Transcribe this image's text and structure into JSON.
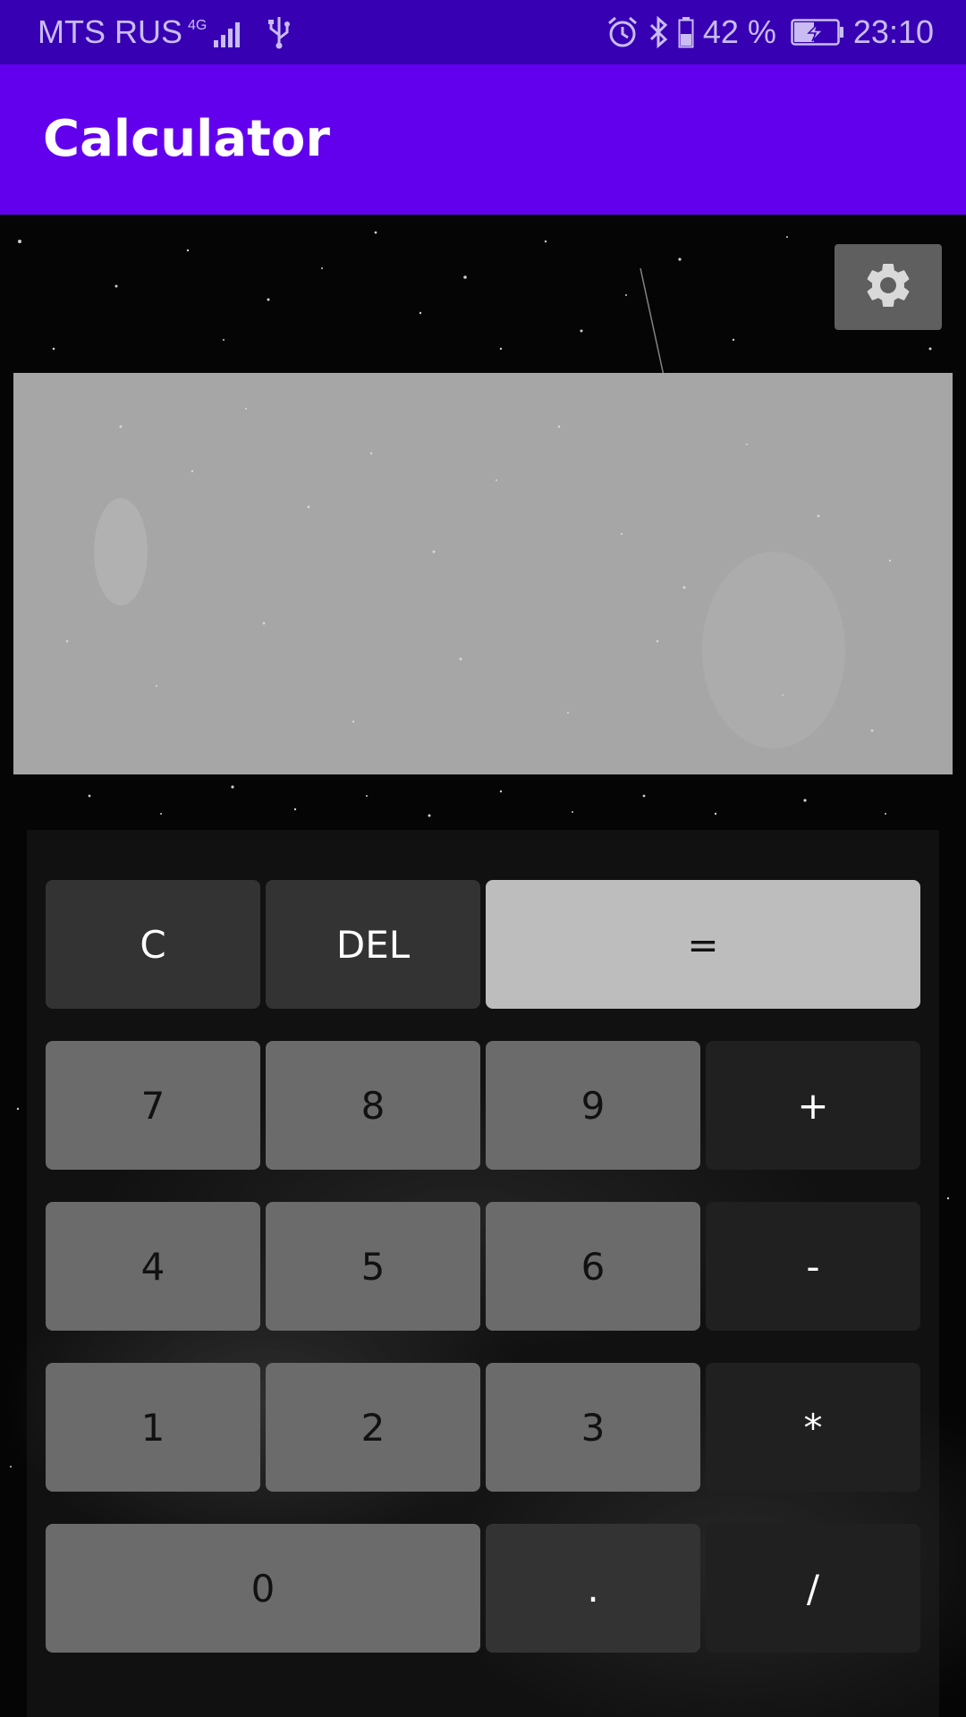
{
  "status_bar": {
    "carrier": "MTS RUS",
    "network": "4G",
    "battery_percent": "42 %",
    "time": "23:10",
    "icons": [
      "signal-icon",
      "usb-icon",
      "alarm-icon",
      "bluetooth-icon",
      "battery-icon",
      "charging-icon"
    ]
  },
  "app_bar": {
    "title": "Calculator"
  },
  "settings": {
    "icon": "gear-icon"
  },
  "display": {
    "value": ""
  },
  "keys": {
    "clear": "C",
    "delete": "DEL",
    "equals": "=",
    "seven": "7",
    "eight": "8",
    "nine": "9",
    "plus": "+",
    "four": "4",
    "five": "5",
    "six": "6",
    "minus": "-",
    "one": "1",
    "two": "2",
    "three": "3",
    "multiply": "*",
    "zero": "0",
    "dot": ".",
    "divide": "/"
  },
  "colors": {
    "status_bar": "#3700b3",
    "app_bar": "#6200ee",
    "display_panel": "#a6a6a6",
    "digit_key": "#6b6b6b",
    "function_key": "#333333",
    "operator_key": "#202020",
    "equals_key": "#bdbdbd"
  }
}
